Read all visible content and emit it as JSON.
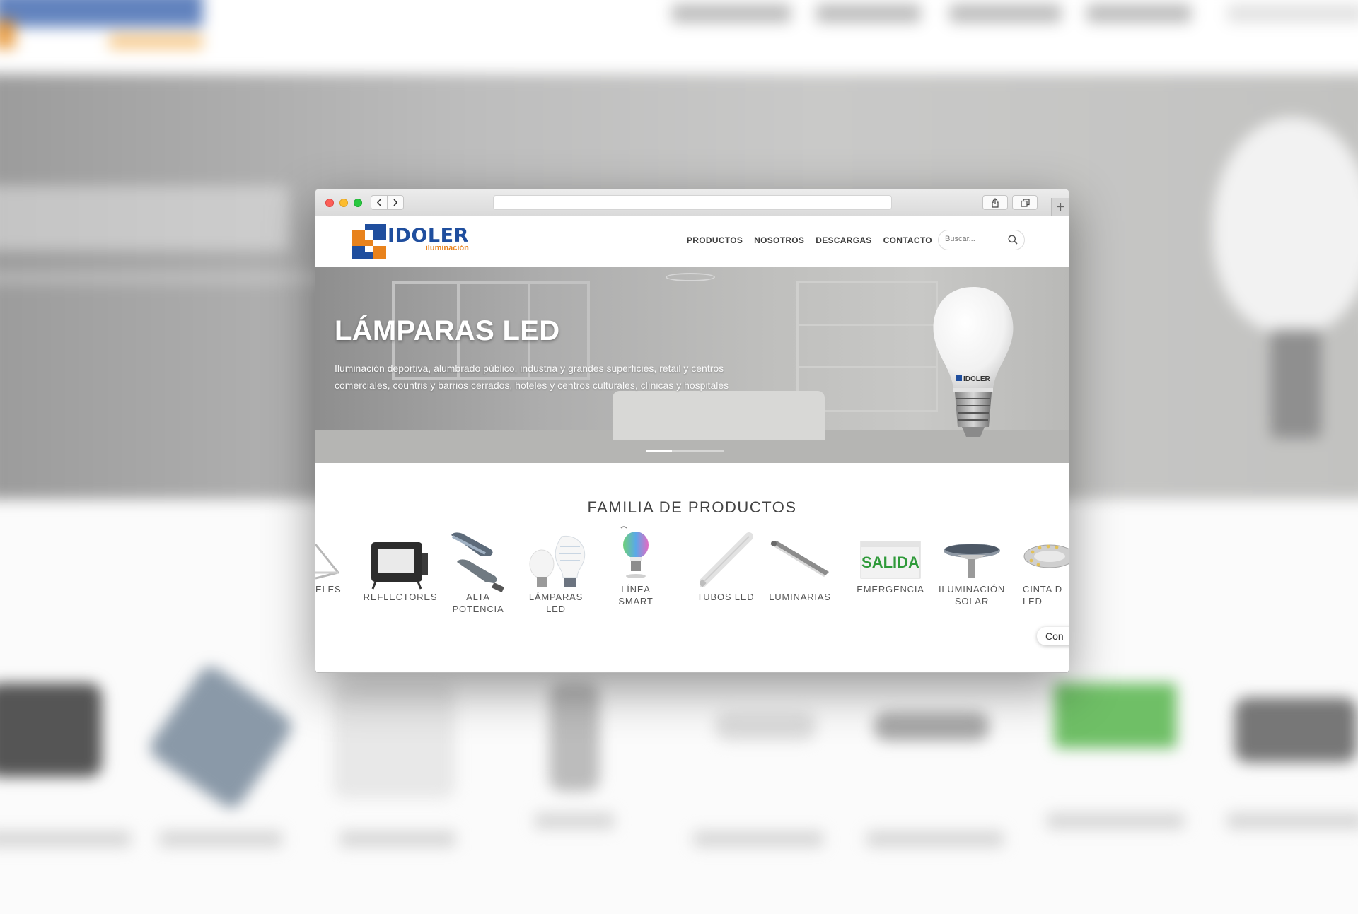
{
  "site": {
    "logo": {
      "brand": "IDOLER",
      "sub": "iluminación"
    },
    "nav": [
      "PRODUCTOS",
      "NOSOTROS",
      "DESCARGAS",
      "CONTACTO"
    ],
    "search": {
      "placeholder": "Buscar..."
    }
  },
  "hero": {
    "title": "LÁMPARAS LED",
    "text": "Iluminación deportiva, alumbrado público, industria y grandes superficies, retail y centros comerciales, countris y barrios cerrados, hoteles y centros culturales, clínicas y hospitales",
    "bulb_brand": "IDOLER",
    "slides_total": 3,
    "slide_active": 1
  },
  "products": {
    "title": "FAMILIA DE PRODUCTOS",
    "items": [
      {
        "label": "ELES",
        "icon": "panel-icon"
      },
      {
        "label": "REFLECTORES",
        "icon": "floodlight-icon"
      },
      {
        "label": "ALTA\nPOTENCIA",
        "icon": "streetlight-icon"
      },
      {
        "label": "LÁMPARAS\nLED",
        "icon": "bulb-icon"
      },
      {
        "label": "LÍNEA\nSMART",
        "icon": "smart-bulb-icon"
      },
      {
        "label": "TUBOS LED",
        "icon": "tube-icon"
      },
      {
        "label": "LUMINARIAS",
        "icon": "luminaire-icon"
      },
      {
        "label": "EMERGENCIA",
        "icon": "exit-sign-icon",
        "sign_text": "SALIDA"
      },
      {
        "label": "ILUMINACIÓN\nSOLAR",
        "icon": "solar-lamp-icon"
      },
      {
        "label": "CINTA D\nLED",
        "icon": "led-strip-icon"
      }
    ]
  },
  "chat": {
    "label": "Con"
  },
  "colors": {
    "brand_blue": "#1f4e9e",
    "brand_orange": "#e8821c",
    "exit_green": "#2f9a3a"
  }
}
